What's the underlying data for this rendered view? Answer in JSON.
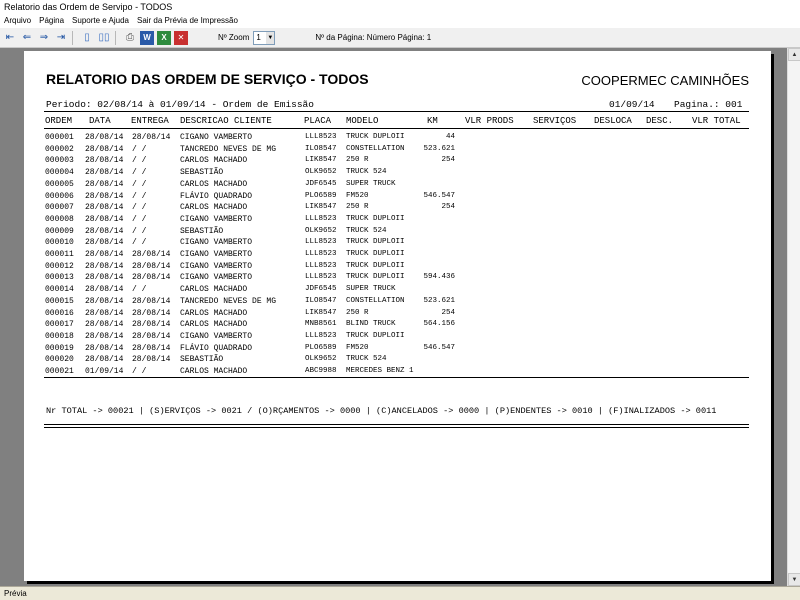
{
  "window": {
    "title": "Relatorio das Ordem de Servipo - TODOS"
  },
  "menu": [
    "Arquivo",
    "Página",
    "Suporte e Ajuda",
    "Sair da Prévia de Impressão"
  ],
  "toolbar": {
    "zoom_label": "Nº Zoom",
    "zoom_value": "1",
    "page_label": "Nº da Página: Número Página: 1"
  },
  "status": "Prévia",
  "report": {
    "title": "RELATORIO DAS ORDEM DE SERVIÇO - TODOS",
    "company": "COOPERMEC CAMINHÕES",
    "periodo": "Periodo: 02/08/14 à 01/09/14 - Ordem de Emissão",
    "date": "01/09/14",
    "pagina": "Pagina.: 001",
    "columns": [
      "ORDEM",
      "DATA",
      "ENTREGA",
      "DESCRICAO CLIENTE",
      "PLACA",
      "MODELO",
      "KM",
      "VLR PRODS",
      "SERVIÇOS",
      "DESLOCA",
      "DESC.",
      "VLR TOTAL"
    ],
    "rows": [
      {
        "ordem": "000001",
        "data": "28/08/14",
        "entrega": "28/08/14",
        "cliente": "CIGANO VAMBERTO",
        "placa": "LLL8523",
        "modelo": "TRUCK DUPLOII",
        "km": "44"
      },
      {
        "ordem": "000002",
        "data": "28/08/14",
        "entrega": "/  /",
        "cliente": "TANCREDO NEVES DE MG",
        "placa": "ILO8547",
        "modelo": "CONSTELLATION",
        "km": "523.621"
      },
      {
        "ordem": "000003",
        "data": "28/08/14",
        "entrega": "/  /",
        "cliente": "CARLOS MACHADO",
        "placa": "LIK8547",
        "modelo": "250 R",
        "km": "254"
      },
      {
        "ordem": "000004",
        "data": "28/08/14",
        "entrega": "/  /",
        "cliente": "SEBASTIÃO",
        "placa": "OLK9652",
        "modelo": "TRUCK 524",
        "km": ""
      },
      {
        "ordem": "000005",
        "data": "28/08/14",
        "entrega": "/  /",
        "cliente": "CARLOS MACHADO",
        "placa": "JDF6545",
        "modelo": "SUPER TRUCK",
        "km": ""
      },
      {
        "ordem": "000006",
        "data": "28/08/14",
        "entrega": "/  /",
        "cliente": "FLÁVIO QUADRADO",
        "placa": "PLO6589",
        "modelo": "FM520",
        "km": "546.547"
      },
      {
        "ordem": "000007",
        "data": "28/08/14",
        "entrega": "/  /",
        "cliente": "CARLOS MACHADO",
        "placa": "LIK8547",
        "modelo": "250 R",
        "km": "254"
      },
      {
        "ordem": "000008",
        "data": "28/08/14",
        "entrega": "/  /",
        "cliente": "CIGANO VAMBERTO",
        "placa": "LLL8523",
        "modelo": "TRUCK DUPLOII",
        "km": ""
      },
      {
        "ordem": "000009",
        "data": "28/08/14",
        "entrega": "/  /",
        "cliente": "SEBASTIÃO",
        "placa": "OLK9652",
        "modelo": "TRUCK 524",
        "km": ""
      },
      {
        "ordem": "000010",
        "data": "28/08/14",
        "entrega": "/  /",
        "cliente": "CIGANO VAMBERTO",
        "placa": "LLL8523",
        "modelo": "TRUCK DUPLOII",
        "km": ""
      },
      {
        "ordem": "000011",
        "data": "28/08/14",
        "entrega": "28/08/14",
        "cliente": "CIGANO VAMBERTO",
        "placa": "LLL8523",
        "modelo": "TRUCK DUPLOII",
        "km": ""
      },
      {
        "ordem": "000012",
        "data": "28/08/14",
        "entrega": "28/08/14",
        "cliente": "CIGANO VAMBERTO",
        "placa": "LLL8523",
        "modelo": "TRUCK DUPLOII",
        "km": ""
      },
      {
        "ordem": "000013",
        "data": "28/08/14",
        "entrega": "28/08/14",
        "cliente": "CIGANO VAMBERTO",
        "placa": "LLL8523",
        "modelo": "TRUCK DUPLOII",
        "km": "594.436"
      },
      {
        "ordem": "000014",
        "data": "28/08/14",
        "entrega": "/  /",
        "cliente": "CARLOS MACHADO",
        "placa": "JDF6545",
        "modelo": "SUPER TRUCK",
        "km": ""
      },
      {
        "ordem": "000015",
        "data": "28/08/14",
        "entrega": "28/08/14",
        "cliente": "TANCREDO NEVES DE MG",
        "placa": "ILO8547",
        "modelo": "CONSTELLATION",
        "km": "523.621"
      },
      {
        "ordem": "000016",
        "data": "28/08/14",
        "entrega": "28/08/14",
        "cliente": "CARLOS MACHADO",
        "placa": "LIK8547",
        "modelo": "250 R",
        "km": "254"
      },
      {
        "ordem": "000017",
        "data": "28/08/14",
        "entrega": "28/08/14",
        "cliente": "CARLOS MACHADO",
        "placa": "MNB8561",
        "modelo": "BLIND TRUCK",
        "km": "564.156"
      },
      {
        "ordem": "000018",
        "data": "28/08/14",
        "entrega": "28/08/14",
        "cliente": "CIGANO VAMBERTO",
        "placa": "LLL8523",
        "modelo": "TRUCK DUPLOII",
        "km": ""
      },
      {
        "ordem": "000019",
        "data": "28/08/14",
        "entrega": "28/08/14",
        "cliente": "FLÁVIO QUADRADO",
        "placa": "PLO6589",
        "modelo": "FM520",
        "km": "546.547"
      },
      {
        "ordem": "000020",
        "data": "28/08/14",
        "entrega": "28/08/14",
        "cliente": "SEBASTIÃO",
        "placa": "OLK9652",
        "modelo": "TRUCK 524",
        "km": ""
      },
      {
        "ordem": "000021",
        "data": "01/09/14",
        "entrega": "/  /",
        "cliente": "CARLOS MACHADO",
        "placa": "ABC9988",
        "modelo": "MERCEDES BENZ 1",
        "km": ""
      }
    ],
    "totals": "Nr TOTAL -> 00021 | (S)ERVIÇOS -> 0021 / (O)RÇAMENTOS -> 0000 | (C)ANCELADOS -> 0000 | (P)ENDENTES -> 0010 | (F)INALIZADOS -> 0011"
  }
}
